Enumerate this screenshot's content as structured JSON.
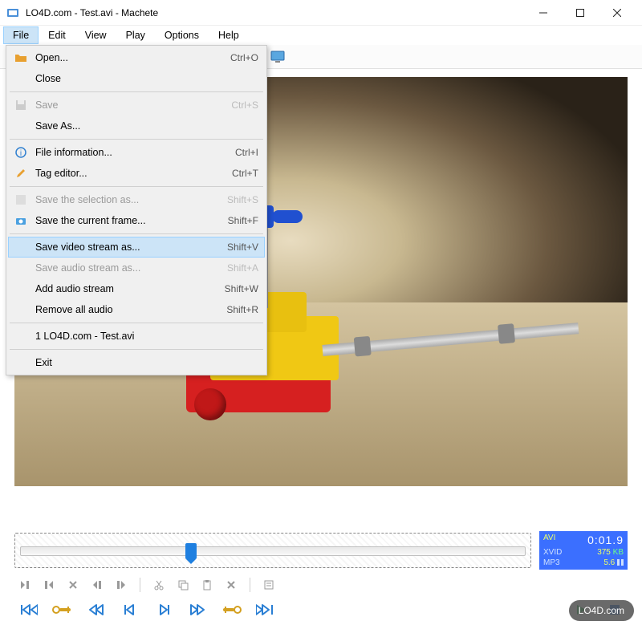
{
  "titlebar": {
    "title": "LO4D.com - Test.avi - Machete"
  },
  "menubar": [
    "File",
    "Edit",
    "View",
    "Play",
    "Options",
    "Help"
  ],
  "dropdown": {
    "open": "Open...",
    "open_sc": "Ctrl+O",
    "close": "Close",
    "save": "Save",
    "save_sc": "Ctrl+S",
    "saveas": "Save As...",
    "info": "File information...",
    "info_sc": "Ctrl+I",
    "tag": "Tag editor...",
    "tag_sc": "Ctrl+T",
    "savesel": "Save the selection as...",
    "savesel_sc": "Shift+S",
    "saveframe": "Save the current frame...",
    "saveframe_sc": "Shift+F",
    "savevideo": "Save video stream as...",
    "savevideo_sc": "Shift+V",
    "saveaudio": "Save audio stream as...",
    "saveaudio_sc": "Shift+A",
    "addaudio": "Add audio stream",
    "addaudio_sc": "Shift+W",
    "rmaudio": "Remove all audio",
    "rmaudio_sc": "Shift+R",
    "recent": "1 LO4D.com - Test.avi",
    "exit": "Exit"
  },
  "info": {
    "format": "AVI",
    "time": "0:01.9",
    "video": "XVID",
    "video_kb": "375",
    "kb": "KB",
    "audio": "MP3",
    "audio_kb": "5.6"
  },
  "watermark": "LO4D.com"
}
